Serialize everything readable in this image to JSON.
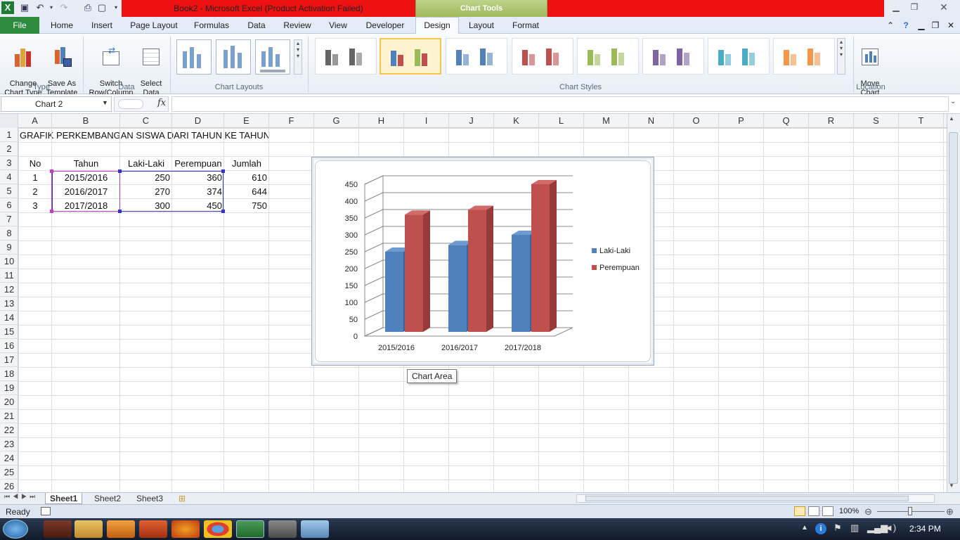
{
  "window": {
    "title": "Book2  -  Microsoft Excel (Product Activation Failed)",
    "contextual_tab_group": "Chart Tools"
  },
  "colors": {
    "title_red": "#ee1111",
    "file_green": "#2d8a3e",
    "series_laki": "#4f81bd",
    "series_perempuan": "#c0504d"
  },
  "ribbon": {
    "tabs": [
      "File",
      "Home",
      "Insert",
      "Page Layout",
      "Formulas",
      "Data",
      "Review",
      "View",
      "Developer",
      "Design",
      "Layout",
      "Format"
    ],
    "active_tab": "Design",
    "groups": {
      "type": {
        "label": "Type",
        "change_chart_type": "Change\nChart Type",
        "save_as_template": "Save As\nTemplate"
      },
      "data": {
        "label": "Data",
        "switch_row_column": "Switch\nRow/Column",
        "select_data": "Select\nData"
      },
      "chart_layouts": {
        "label": "Chart Layouts"
      },
      "chart_styles": {
        "label": "Chart Styles"
      },
      "location": {
        "label": "Location",
        "move_chart": "Move\nChart"
      }
    }
  },
  "formula_bar": {
    "name_box": "Chart 2",
    "fx": "fx",
    "formula": ""
  },
  "columns": [
    "A",
    "B",
    "C",
    "D",
    "E",
    "F",
    "G",
    "H",
    "I",
    "J",
    "K",
    "L",
    "M",
    "N",
    "O",
    "P",
    "Q",
    "R",
    "S",
    "T"
  ],
  "rows": [
    "1",
    "2",
    "3",
    "4",
    "5",
    "6",
    "7",
    "8",
    "9",
    "10",
    "11",
    "12",
    "13",
    "14",
    "15",
    "16",
    "17",
    "18",
    "19",
    "20",
    "21",
    "22",
    "23",
    "24",
    "25",
    "26"
  ],
  "sheet": {
    "title": "GRAFIK PERKEMBANGAN SISWA DARI TAHUN KE TAHUN",
    "headers": [
      "No",
      "Tahun",
      "Laki-Laki",
      "Perempuan",
      "Jumlah"
    ],
    "rows": [
      [
        "1",
        "2015/2016",
        "250",
        "360",
        "610"
      ],
      [
        "2",
        "2016/2017",
        "270",
        "374",
        "644"
      ],
      [
        "3",
        "2017/2018",
        "300",
        "450",
        "750"
      ]
    ]
  },
  "chart_data": {
    "type": "bar",
    "variant": "3d-clustered-column",
    "categories": [
      "2015/2016",
      "2016/2017",
      "2017/2018"
    ],
    "series": [
      {
        "name": "Laki-Laki",
        "values": [
          250,
          270,
          300
        ]
      },
      {
        "name": "Perempuan",
        "values": [
          360,
          374,
          450
        ]
      }
    ],
    "title": "",
    "xlabel": "",
    "ylabel": "",
    "ylim": [
      0,
      450
    ],
    "yticks": [
      "0",
      "50",
      "100",
      "150",
      "200",
      "250",
      "300",
      "350",
      "400",
      "450"
    ],
    "grid": true,
    "legend_position": "right"
  },
  "tooltip": "Chart Area",
  "sheet_tabs": [
    "Sheet1",
    "Sheet2",
    "Sheet3"
  ],
  "active_sheet": "Sheet1",
  "status": {
    "ready": "Ready",
    "zoom": "100%"
  },
  "taskbar": {
    "time": "2:34 PM"
  }
}
